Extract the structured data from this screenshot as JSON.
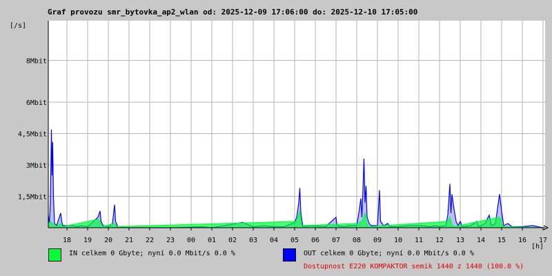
{
  "title": "Graf provozu smr_bytovka_ap2_wlan od: 2025-12-09 17:06:00 do: 2025-12-10 17:05:00",
  "colors": {
    "in": "#00ff33",
    "out": "#0000ff",
    "background": "#c8c8c8",
    "plot": "#ffffff",
    "grid": "#b4b4b4",
    "availability": "#e00000"
  },
  "legend": {
    "in_label": "IN celkem 0 Gbyte; nyní   0.0 Mbit/s 0.0 %",
    "out_label": "OUT celkem 0 Gbyte; nyní   0.0 Mbit/s 0.0 %",
    "availability": "Dostupnost E220 KOMPAKTOR semik 1440 z 1440 (100.0 %)"
  },
  "chart_data": {
    "type": "area",
    "title": "Graf provozu smr_bytovka_ap2_wlan od: 2025-12-09 17:06:00 do: 2025-12-10 17:05:00",
    "ylabel": "[/s]",
    "xlabel": "[h]",
    "ylim": [
      0,
      9.9
    ],
    "xlim": [
      17.1,
      41.1
    ],
    "grid": true,
    "legend_position": "bottom",
    "y_ticks": [
      {
        "value": 1.5,
        "label": "1,5Mbit"
      },
      {
        "value": 3,
        "label": "3Mbit"
      },
      {
        "value": 4.5,
        "label": "4,5Mbit"
      },
      {
        "value": 6,
        "label": "6Mbit"
      },
      {
        "value": 8,
        "label": "8Mbit"
      }
    ],
    "x_ticks": [
      {
        "value": 18,
        "label": "18"
      },
      {
        "value": 19,
        "label": "19"
      },
      {
        "value": 20,
        "label": "20"
      },
      {
        "value": 21,
        "label": "21"
      },
      {
        "value": 22,
        "label": "22"
      },
      {
        "value": 23,
        "label": "23"
      },
      {
        "value": 24,
        "label": "00"
      },
      {
        "value": 25,
        "label": "01"
      },
      {
        "value": 26,
        "label": "02"
      },
      {
        "value": 27,
        "label": "03"
      },
      {
        "value": 28,
        "label": "04"
      },
      {
        "value": 29,
        "label": "05"
      },
      {
        "value": 30,
        "label": "06"
      },
      {
        "value": 31,
        "label": "07"
      },
      {
        "value": 32,
        "label": "08"
      },
      {
        "value": 33,
        "label": "09"
      },
      {
        "value": 34,
        "label": "10"
      },
      {
        "value": 35,
        "label": "11"
      },
      {
        "value": 36,
        "label": "12"
      },
      {
        "value": 37,
        "label": "13"
      },
      {
        "value": 38,
        "label": "14"
      },
      {
        "value": 39,
        "label": "15"
      },
      {
        "value": 40,
        "label": "16"
      },
      {
        "value": 41,
        "label": "17"
      }
    ],
    "series": [
      {
        "name": "OUT",
        "color": "#0000ff",
        "points": [
          [
            17.1,
            0.6
          ],
          [
            17.15,
            0.2
          ],
          [
            17.2,
            1.2
          ],
          [
            17.25,
            4.7
          ],
          [
            17.28,
            2.5
          ],
          [
            17.31,
            4.1
          ],
          [
            17.35,
            1.5
          ],
          [
            17.4,
            0.2
          ],
          [
            17.5,
            0.1
          ],
          [
            17.7,
            0.7
          ],
          [
            17.75,
            0.3
          ],
          [
            17.8,
            0.1
          ],
          [
            18.0,
            0.1
          ],
          [
            18.3,
            0.1
          ],
          [
            18.5,
            0.05
          ],
          [
            18.7,
            0.1
          ],
          [
            19.0,
            0.05
          ],
          [
            19.5,
            0.5
          ],
          [
            19.6,
            0.8
          ],
          [
            19.65,
            0.3
          ],
          [
            19.75,
            0.1
          ],
          [
            20.0,
            0.05
          ],
          [
            20.2,
            0.2
          ],
          [
            20.3,
            1.1
          ],
          [
            20.35,
            0.3
          ],
          [
            20.45,
            0.05
          ],
          [
            21.0,
            0.0
          ],
          [
            22.0,
            0.0
          ],
          [
            23.0,
            0.0
          ],
          [
            24.5,
            0.05
          ],
          [
            25.0,
            0.0
          ],
          [
            26.5,
            0.25
          ],
          [
            27.0,
            0.05
          ],
          [
            27.5,
            0.1
          ],
          [
            28.0,
            0.05
          ],
          [
            28.5,
            0.05
          ],
          [
            29.0,
            0.25
          ],
          [
            29.1,
            0.5
          ],
          [
            29.2,
            1.2
          ],
          [
            29.25,
            1.9
          ],
          [
            29.3,
            0.7
          ],
          [
            29.4,
            0.05
          ],
          [
            29.8,
            0.1
          ],
          [
            30.5,
            0.05
          ],
          [
            31.0,
            0.5
          ],
          [
            31.05,
            0.1
          ],
          [
            31.4,
            0.05
          ],
          [
            31.6,
            0.1
          ],
          [
            32.0,
            0.1
          ],
          [
            32.1,
            0.7
          ],
          [
            32.2,
            1.4
          ],
          [
            32.25,
            0.5
          ],
          [
            32.3,
            1.8
          ],
          [
            32.35,
            3.3
          ],
          [
            32.4,
            1.2
          ],
          [
            32.45,
            2.0
          ],
          [
            32.5,
            0.5
          ],
          [
            32.6,
            0.2
          ],
          [
            32.7,
            0.1
          ],
          [
            33.0,
            0.1
          ],
          [
            33.1,
            1.8
          ],
          [
            33.15,
            0.3
          ],
          [
            33.3,
            0.1
          ],
          [
            33.5,
            0.2
          ],
          [
            33.6,
            0.05
          ],
          [
            34.0,
            0.05
          ],
          [
            34.5,
            0.1
          ],
          [
            35.0,
            0.1
          ],
          [
            35.2,
            0.1
          ],
          [
            35.5,
            0.05
          ],
          [
            35.8,
            0.1
          ],
          [
            36.0,
            0.05
          ],
          [
            36.3,
            0.1
          ],
          [
            36.4,
            0.6
          ],
          [
            36.5,
            2.1
          ],
          [
            36.55,
            0.7
          ],
          [
            36.6,
            1.6
          ],
          [
            36.7,
            0.9
          ],
          [
            36.8,
            0.3
          ],
          [
            36.9,
            0.1
          ],
          [
            37.0,
            0.3
          ],
          [
            37.1,
            0.05
          ],
          [
            37.5,
            0.1
          ],
          [
            37.8,
            0.3
          ],
          [
            37.9,
            0.05
          ],
          [
            38.2,
            0.2
          ],
          [
            38.4,
            0.6
          ],
          [
            38.5,
            0.1
          ],
          [
            38.7,
            0.2
          ],
          [
            38.9,
            1.6
          ],
          [
            39.0,
            0.8
          ],
          [
            39.1,
            0.1
          ],
          [
            39.3,
            0.2
          ],
          [
            39.5,
            0.05
          ],
          [
            40.0,
            0.05
          ],
          [
            40.5,
            0.1
          ],
          [
            41.0,
            0.0
          ]
        ]
      },
      {
        "name": "IN",
        "color": "#00ff33",
        "points": [
          [
            17.1,
            0.2
          ],
          [
            17.2,
            0.3
          ],
          [
            17.25,
            0.25
          ],
          [
            17.35,
            0.15
          ],
          [
            17.45,
            0.05
          ],
          [
            17.7,
            0.2
          ],
          [
            17.8,
            0.05
          ],
          [
            19.5,
            0.4
          ],
          [
            19.6,
            0.3
          ],
          [
            19.7,
            0.05
          ],
          [
            20.3,
            0.2
          ],
          [
            20.4,
            0.05
          ],
          [
            29.1,
            0.3
          ],
          [
            29.25,
            0.8
          ],
          [
            29.35,
            0.1
          ],
          [
            32.1,
            0.2
          ],
          [
            32.3,
            0.4
          ],
          [
            32.4,
            0.7
          ],
          [
            32.5,
            0.2
          ],
          [
            32.6,
            0.05
          ],
          [
            36.4,
            0.3
          ],
          [
            36.5,
            0.5
          ],
          [
            36.6,
            0.15
          ],
          [
            36.7,
            0.05
          ],
          [
            38.9,
            0.5
          ],
          [
            39.0,
            0.2
          ],
          [
            39.1,
            0.05
          ],
          [
            41.0,
            0.0
          ]
        ]
      }
    ]
  }
}
